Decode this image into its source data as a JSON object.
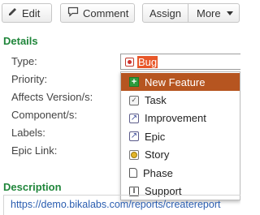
{
  "toolbar": {
    "edit_label": "Edit",
    "comment_label": "Comment",
    "assign_label": "Assign",
    "more_label": "More"
  },
  "details": {
    "title": "Details",
    "fields": {
      "type": "Type:",
      "priority": "Priority:",
      "affects_versions": "Affects Version/s:",
      "components": "Component/s:",
      "labels": "Labels:",
      "epic_link": "Epic Link:"
    },
    "type_value": "Bug",
    "type_icon": "bug-icon",
    "type_options": [
      {
        "label": "New Feature",
        "icon": "new-feature-icon",
        "selected": true
      },
      {
        "label": "Task",
        "icon": "task-icon",
        "selected": false
      },
      {
        "label": "Improvement",
        "icon": "improvement-icon",
        "selected": false
      },
      {
        "label": "Epic",
        "icon": "epic-icon",
        "selected": false
      },
      {
        "label": "Story",
        "icon": "story-icon",
        "selected": false
      },
      {
        "label": "Phase",
        "icon": "phase-icon",
        "selected": false
      },
      {
        "label": "Support",
        "icon": "support-icon",
        "selected": false
      }
    ]
  },
  "description": {
    "title": "Description",
    "link": "https://demo.bikalabs.com/reports/createreport"
  },
  "colors": {
    "section_title": "#20863b",
    "selected_option_bg": "#b65520",
    "type_value_highlight": "#e8582a",
    "link": "#2a5db0"
  }
}
